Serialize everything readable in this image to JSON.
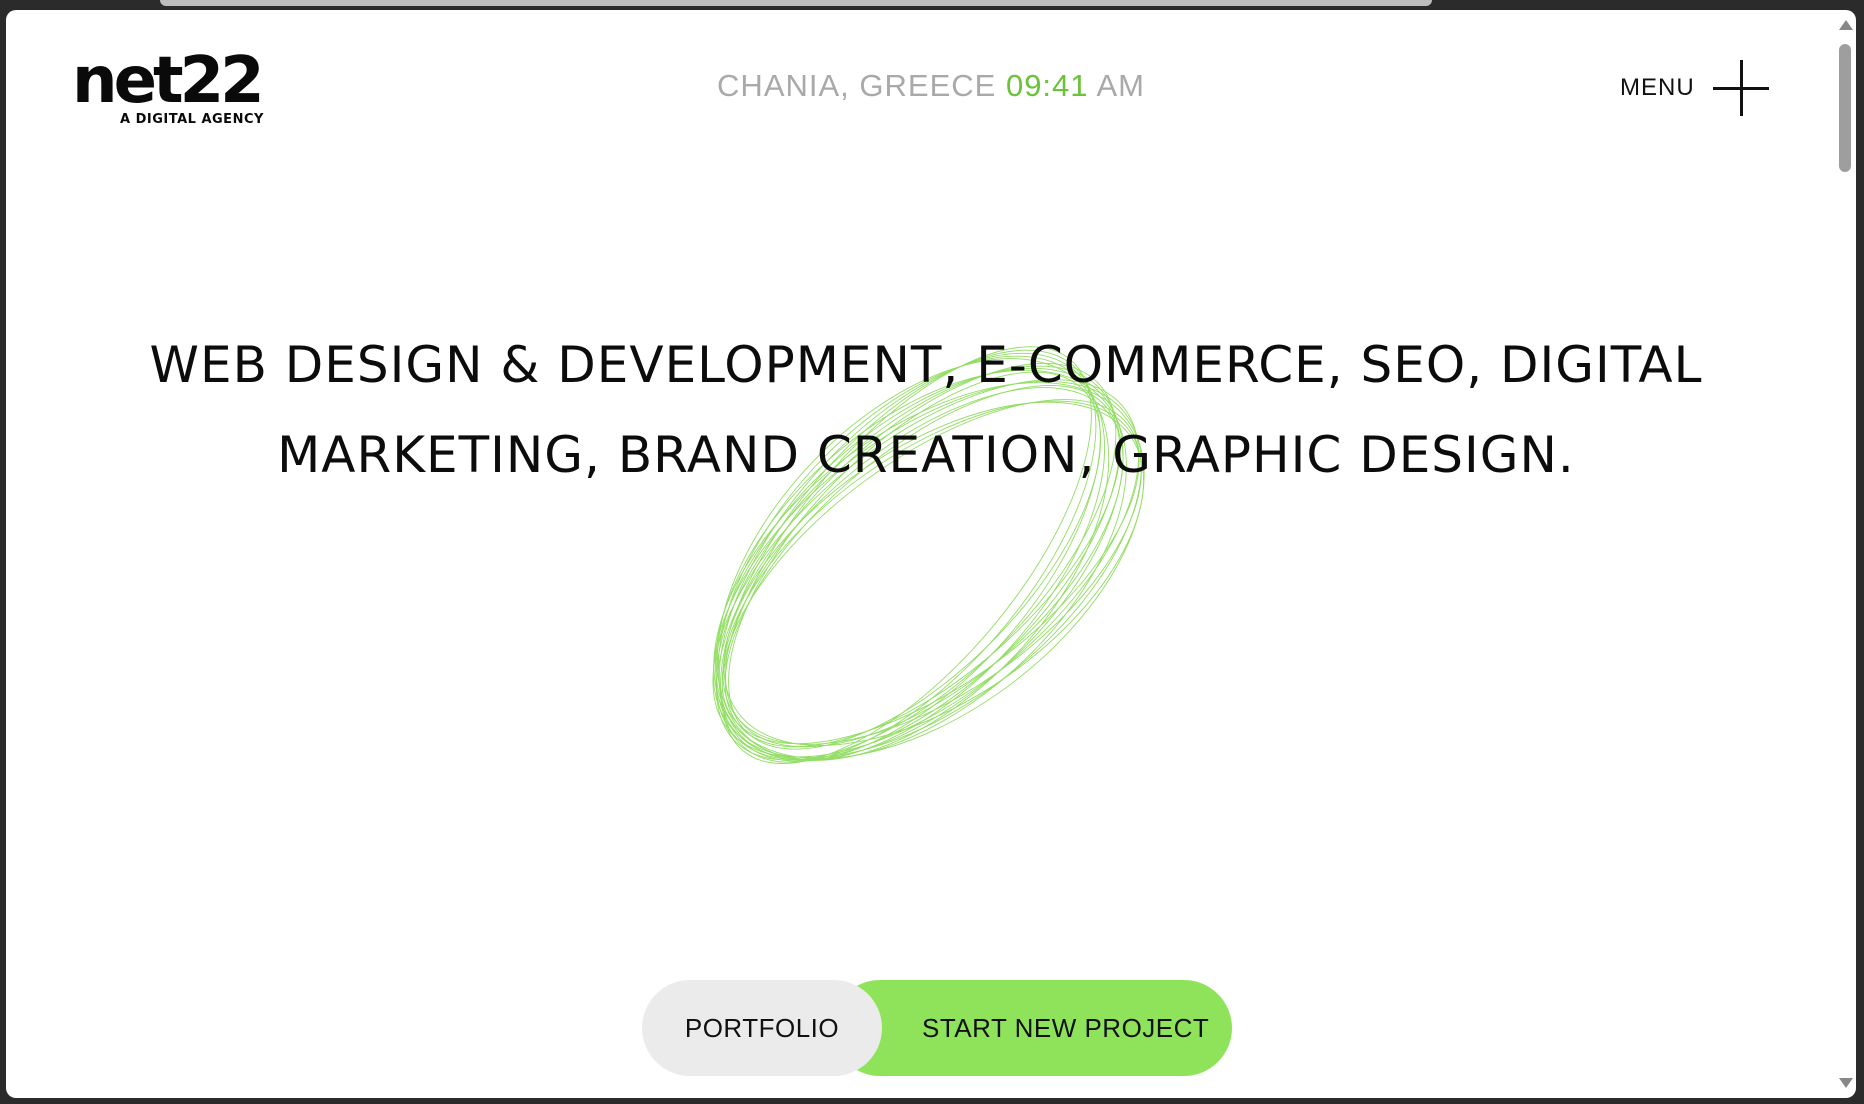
{
  "logo": {
    "wordmark": "net22",
    "tagline": "A DIGITAL AGENCY"
  },
  "header": {
    "location": "CHANIA, GREECE",
    "time": "09:41",
    "meridiem": "AM",
    "menu_label": "MENU",
    "menu_icon": "plus-icon"
  },
  "hero": {
    "headline": "WEB DESIGN & DEVELOPMENT, E-COMMERCE, SEO, DIGITAL MARKETING, BRAND CREATION, GRAPHIC DESIGN."
  },
  "cta": {
    "portfolio_label": "PORTFOLIO",
    "project_label": "START NEW PROJECT"
  },
  "colors": {
    "accent": "#8ee35b",
    "time": "#6cc23a",
    "ring": "#7fd84a",
    "muted_text": "#a9a9a9",
    "button_gray": "#ebebeb"
  }
}
